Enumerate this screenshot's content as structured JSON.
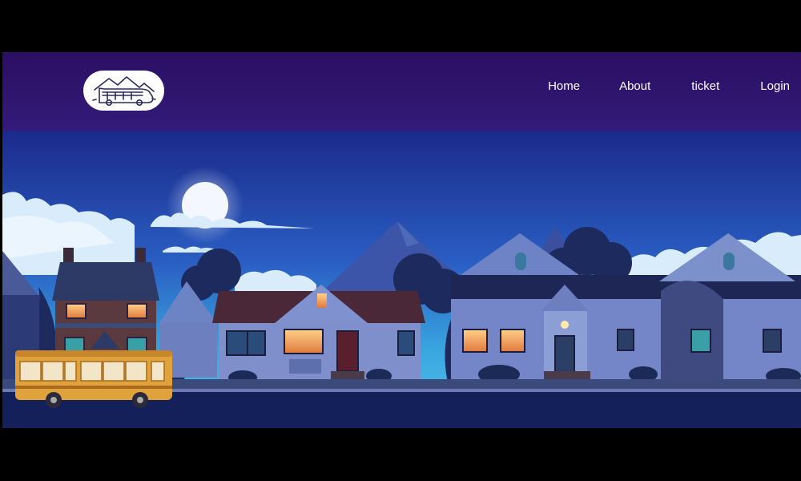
{
  "nav": {
    "items": [
      {
        "id": "home",
        "label": "Home"
      },
      {
        "id": "about",
        "label": "About"
      },
      {
        "id": "ticket",
        "label": "ticket"
      },
      {
        "id": "login",
        "label": "Login"
      }
    ]
  },
  "logo": {
    "icon": "bus-mountain-icon"
  },
  "colors": {
    "navbar": "#2b0f63",
    "sky_top": "#1b2a8a",
    "sky_bottom": "#3aa8e0",
    "road": "#14205a",
    "bus": "#e0a23a",
    "window_light": "#f4a460"
  }
}
